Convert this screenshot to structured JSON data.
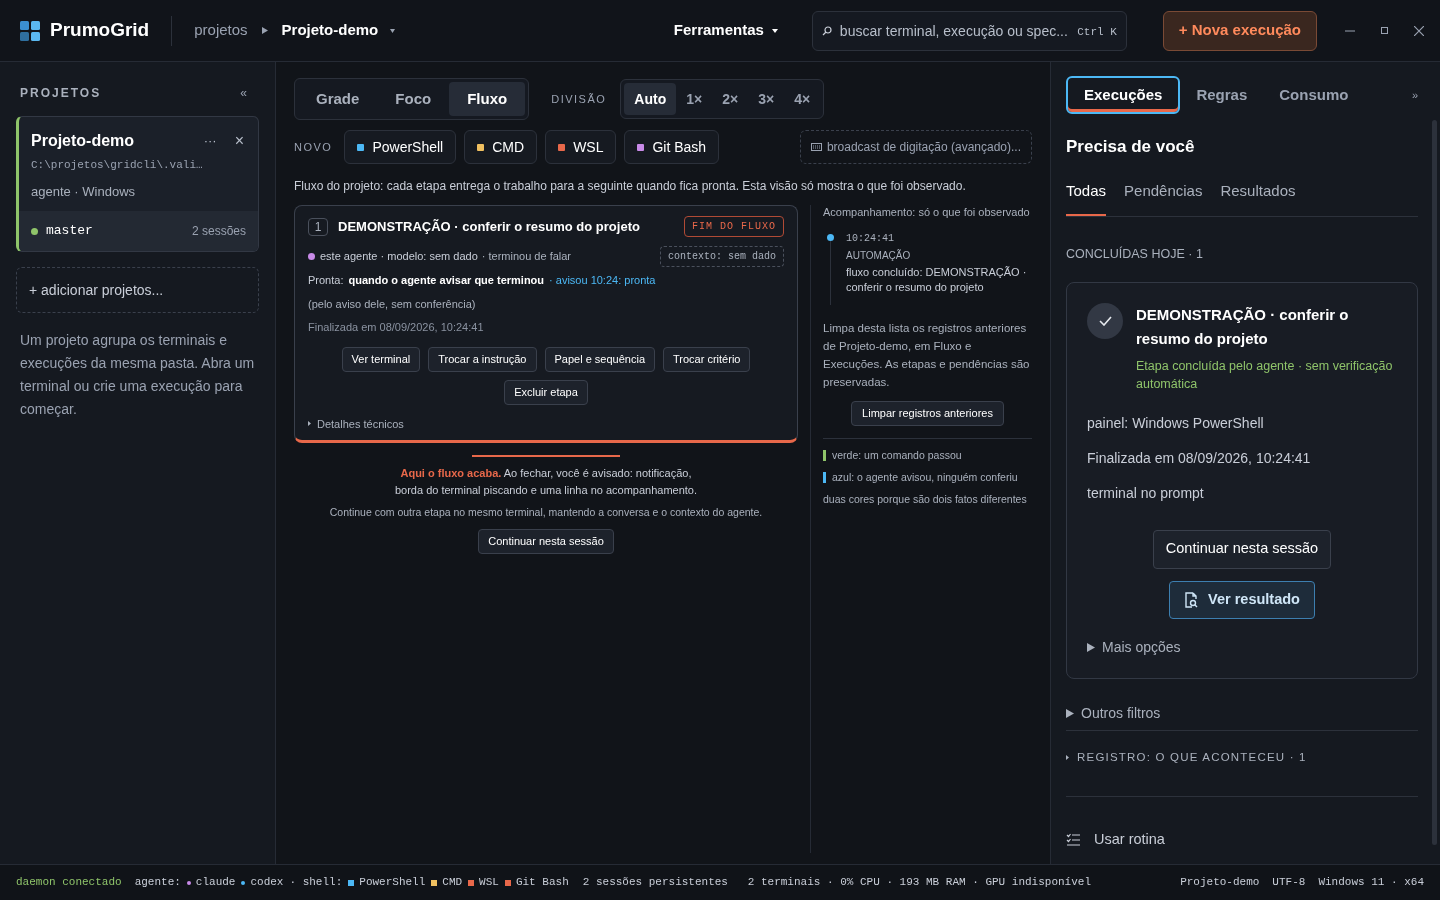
{
  "app": {
    "name": "PrumoGrid"
  },
  "breadcrumb": {
    "root": "projetos",
    "current": "Projeto-demo"
  },
  "menu": {
    "label": "Ferramentas"
  },
  "search": {
    "placeholder": "buscar terminal, execução ou spec...",
    "shortcut": "Ctrl K"
  },
  "primary_button": "+ Nova execução",
  "sidebar": {
    "title": "PROJETOS",
    "collapse": "«",
    "project": {
      "name": "Projeto-demo",
      "path": "C:\\projetos\\gridcli\\.vali…",
      "meta": "agente · Windows",
      "more": "···",
      "close": "×",
      "branch": {
        "name": "master",
        "color": "#8fc46a"
      },
      "sessions": "2 sessões",
      "selected": true
    },
    "add": "+ adicionar projetos...",
    "help": "Um projeto agrupa os terminais e execuções da mesma pasta. Abra um terminal ou crie uma execução para começar."
  },
  "toolbar": {
    "views": [
      {
        "label": "Grade",
        "selected": false
      },
      {
        "label": "Foco",
        "selected": false
      },
      {
        "label": "Fluxo",
        "selected": true
      }
    ],
    "division_label": "DIVISÃO",
    "divisions": [
      {
        "label": "Auto",
        "selected": true
      },
      {
        "label": "1×",
        "selected": false
      },
      {
        "label": "2×",
        "selected": false
      },
      {
        "label": "3×",
        "selected": false
      },
      {
        "label": "4×",
        "selected": false
      }
    ],
    "new_label": "NOVO",
    "shells": [
      {
        "label": "PowerShell",
        "color": "#4cb8f5"
      },
      {
        "label": "CMD",
        "color": "#f0c060"
      },
      {
        "label": "WSL",
        "color": "#e8684a"
      },
      {
        "label": "Git Bash",
        "color": "#c88ae8"
      }
    ],
    "broadcast": "broadcast de digitação (avançado)..."
  },
  "flow_note": "Fluxo do projeto: cada etapa entrega o trabalho para a seguinte quando fica pronta. Esta visão só mostra o que foi observado.",
  "step": {
    "number": "1",
    "title": "DEMONSTRAÇÃO · conferir o resumo do projeto",
    "badge": "FIM DO FLUXO",
    "agent": {
      "color": "#c88ae8"
    },
    "meta": "este agente · modelo: sem dado",
    "status": "· terminou de falar",
    "context": "contexto: sem dado",
    "ready_label": "Pronta:",
    "ready_value": "quando o agente avisar que terminou",
    "ready_notice": "· avisou 10:24: pronta",
    "note": "(pelo aviso dele, sem conferência)",
    "finished": "Finalizada em 08/09/2026, 10:24:41",
    "actions": [
      "Ver terminal",
      "Trocar a instrução",
      "Papel e sequência",
      "Trocar critério"
    ],
    "delete": "Excluir etapa",
    "details": "Detalhes técnicos"
  },
  "flow_end": {
    "highlight": "Aqui o fluxo acaba.",
    "text": "Ao fechar, você é avisado: notificação, borda do terminal piscando e uma linha no acompanhamento.",
    "continue_note": "Continue com outra etapa no mesmo terminal, mantendo a conversa e o contexto do agente.",
    "continue_button": "Continuar nesta sessão"
  },
  "tracking": {
    "title": "Acompanhamento: só o que foi observado",
    "events": [
      {
        "time": "10:24:41",
        "kind": "AUTOMAÇÃO",
        "text": "fluxo concluído: DEMONSTRAÇÃO · conferir o resumo do projeto",
        "color": "#4cb8f5"
      }
    ],
    "clear_text": "Limpa desta lista os registros anteriores de Projeto-demo, em Fluxo e Execuções. As etapas e pendências são preservadas.",
    "clear_button": "Limpar registros anteriores",
    "legend": [
      {
        "text": "verde: um comando passou",
        "color": "#8fc46a"
      },
      {
        "text": "azul: o agente avisou, ninguém conferiu",
        "color": "#4cb8f5"
      }
    ],
    "legend_note": "duas cores porque são dois fatos diferentes"
  },
  "right_panel": {
    "tabs": [
      {
        "label": "Execuções",
        "selected": true
      },
      {
        "label": "Regras",
        "selected": false
      },
      {
        "label": "Consumo",
        "selected": false
      }
    ],
    "expand": "»",
    "heading": "Precisa de você",
    "filters": [
      {
        "label": "Todas",
        "selected": true
      },
      {
        "label": "Pendências",
        "selected": false
      },
      {
        "label": "Resultados",
        "selected": false
      }
    ],
    "section": "CONCLUÍDAS HOJE · 1",
    "result": {
      "title": "DEMONSTRAÇÃO · conferir o resumo do projeto",
      "subtitle": "Etapa concluída pelo agente · sem verificação automática",
      "lines": [
        "painel: Windows PowerShell",
        "Finalizada em 08/09/2026, 10:24:41",
        "terminal no prompt"
      ],
      "continue_button": "Continuar nesta sessão",
      "view_button": "Ver resultado",
      "more": "Mais opções"
    },
    "other_filters": "Outros filtros",
    "registry": "REGISTRO: O QUE ACONTECEU · 1",
    "routine": "Usar rotina"
  },
  "status_bar": {
    "daemon": "daemon conectado",
    "agent_label": "agente:",
    "agents": [
      {
        "label": "claude",
        "color": "#c88ae8"
      },
      {
        "label": "codex",
        "color": "#4cb8f5"
      }
    ],
    "shell_label": "· shell:",
    "shells": [
      {
        "label": "PowerShell",
        "color": "#4cb8f5"
      },
      {
        "label": "CMD",
        "color": "#f0c060"
      },
      {
        "label": "WSL",
        "color": "#e8684a"
      },
      {
        "label": "Git Bash",
        "color": "#e8684a"
      }
    ],
    "stats": "2 sessões persistentes   2 terminais · 0% CPU · 193 MB RAM · GPU indisponível",
    "right": [
      "Projeto-demo",
      "UTF-8",
      "Windows 11 · x64"
    ]
  }
}
